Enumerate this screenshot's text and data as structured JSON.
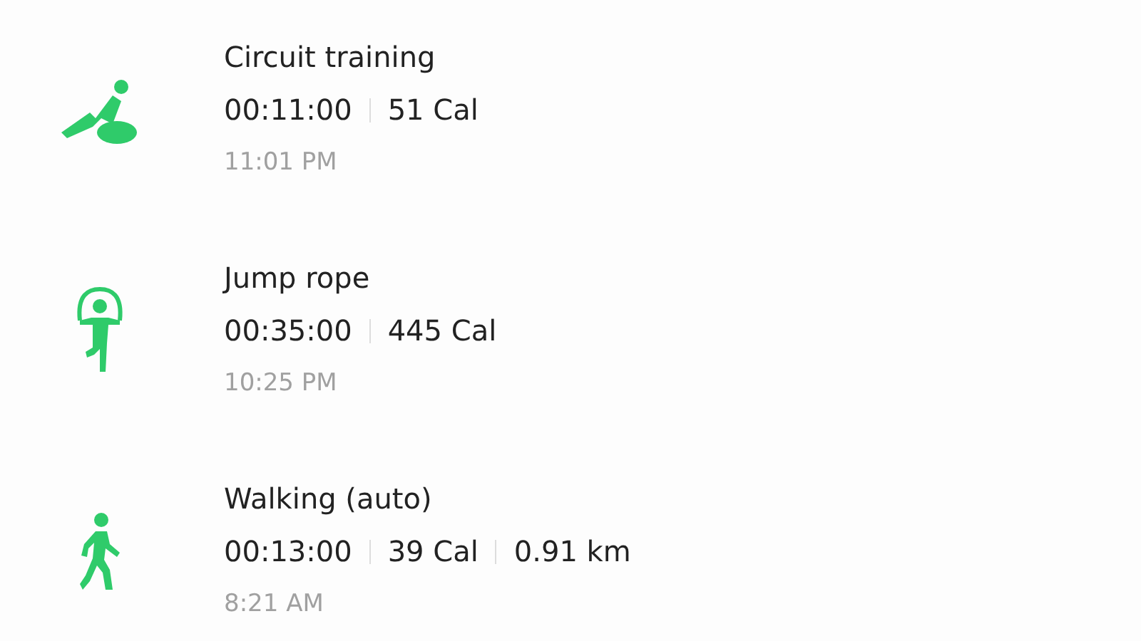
{
  "activities": [
    {
      "kind": "circuit",
      "name": "Circuit training",
      "stats": [
        "00:11:00",
        "51 Cal"
      ],
      "time": "11:01 PM"
    },
    {
      "kind": "jumprope",
      "name": "Jump rope",
      "stats": [
        "00:35:00",
        "445 Cal"
      ],
      "time": "10:25 PM"
    },
    {
      "kind": "walking",
      "name": "Walking (auto)",
      "stats": [
        "00:13:00",
        "39 Cal",
        "0.91 km"
      ],
      "time": "8:21 AM"
    }
  ]
}
